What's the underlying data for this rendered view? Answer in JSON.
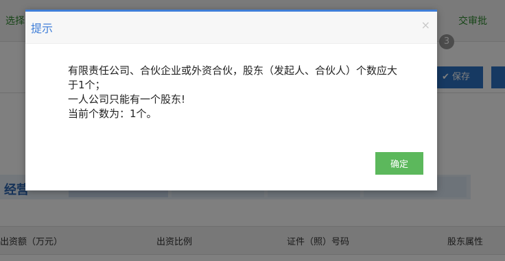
{
  "background": {
    "step_left": "选择",
    "step_right": "交审批",
    "step_number": "3",
    "save_label": "保存",
    "tab_title": "经营",
    "columns": [
      "出资额（万元）",
      "出资比例",
      "证件（照）号码",
      "股东属性"
    ]
  },
  "dialog": {
    "title": "提示",
    "close_icon": "×",
    "lines": [
      "有限责任公司、合伙企业或外资合伙，股东（发起人、合伙人）个数应大于1个；",
      "一人公司只能有一个股东!",
      "当前个数为：1个。"
    ],
    "confirm_label": "确定"
  },
  "colors": {
    "accent": "#3f7ed8",
    "confirm": "#5cb85c",
    "save": "#2d72c4"
  }
}
